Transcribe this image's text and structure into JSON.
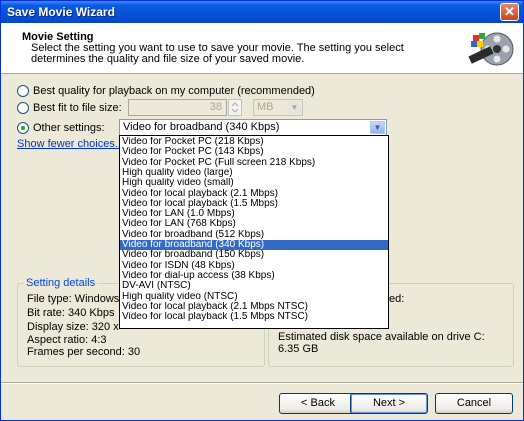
{
  "window": {
    "title": "Save Movie Wizard",
    "close_glyph": "✕"
  },
  "header": {
    "title": "Movie Setting",
    "description": "Select the setting you want to use to save your movie. The setting you select determines the quality and file size of your saved movie.",
    "icon": "film-reel-icon"
  },
  "options": {
    "best_quality": "Best quality for playback on my computer (recommended)",
    "best_fit": "Best fit to file size:",
    "file_size_value": "38",
    "file_size_unit": "MB",
    "other": "Other settings:",
    "selected_setting": "Video for broadband (340 Kbps)",
    "show_fewer": "Show fewer choices..."
  },
  "dropdown_items": [
    "Video for Pocket PC (218 Kbps)",
    "Video for Pocket PC (143 Kbps)",
    "Video for Pocket PC (Full screen 218 Kbps)",
    "High quality video (large)",
    "High quality video (small)",
    "Video for local playback (2.1 Mbps)",
    "Video for local playback (1.5 Mbps)",
    "Video for LAN (1.0 Mbps)",
    "Video for LAN (768 Kbps)",
    "Video for broadband (512 Kbps)",
    "Video for broadband (340 Kbps)",
    "Video for broadband (150 Kbps)",
    "Video for ISDN (48 Kbps)",
    "Video for dial-up access (38 Kbps)",
    "DV-AVI (NTSC)",
    "High quality video (NTSC)",
    "Video for local playback (2.1 Mbps NTSC)",
    "Video for local playback (1.5 Mbps NTSC)"
  ],
  "selected_index": 10,
  "setting_details": {
    "label": "Setting details",
    "file_type": "File type: Windows",
    "bit_rate": "Bit rate: 340 Kbps",
    "display_size": "Display size: 320 x",
    "aspect_ratio": "Aspect ratio: 4:3",
    "fps": "Frames per second: 30"
  },
  "movie_file": {
    "partial_label": "ed:",
    "disk_space_label": "Estimated disk space available on drive C:",
    "disk_space_value": "6.35 GB"
  },
  "buttons": {
    "back": "< Back",
    "next": "Next >",
    "cancel": "Cancel"
  },
  "colors": {
    "title_bar": "#0a5be0",
    "selection": "#316ac5",
    "link": "#0033cc",
    "group_label": "#0046d5"
  }
}
